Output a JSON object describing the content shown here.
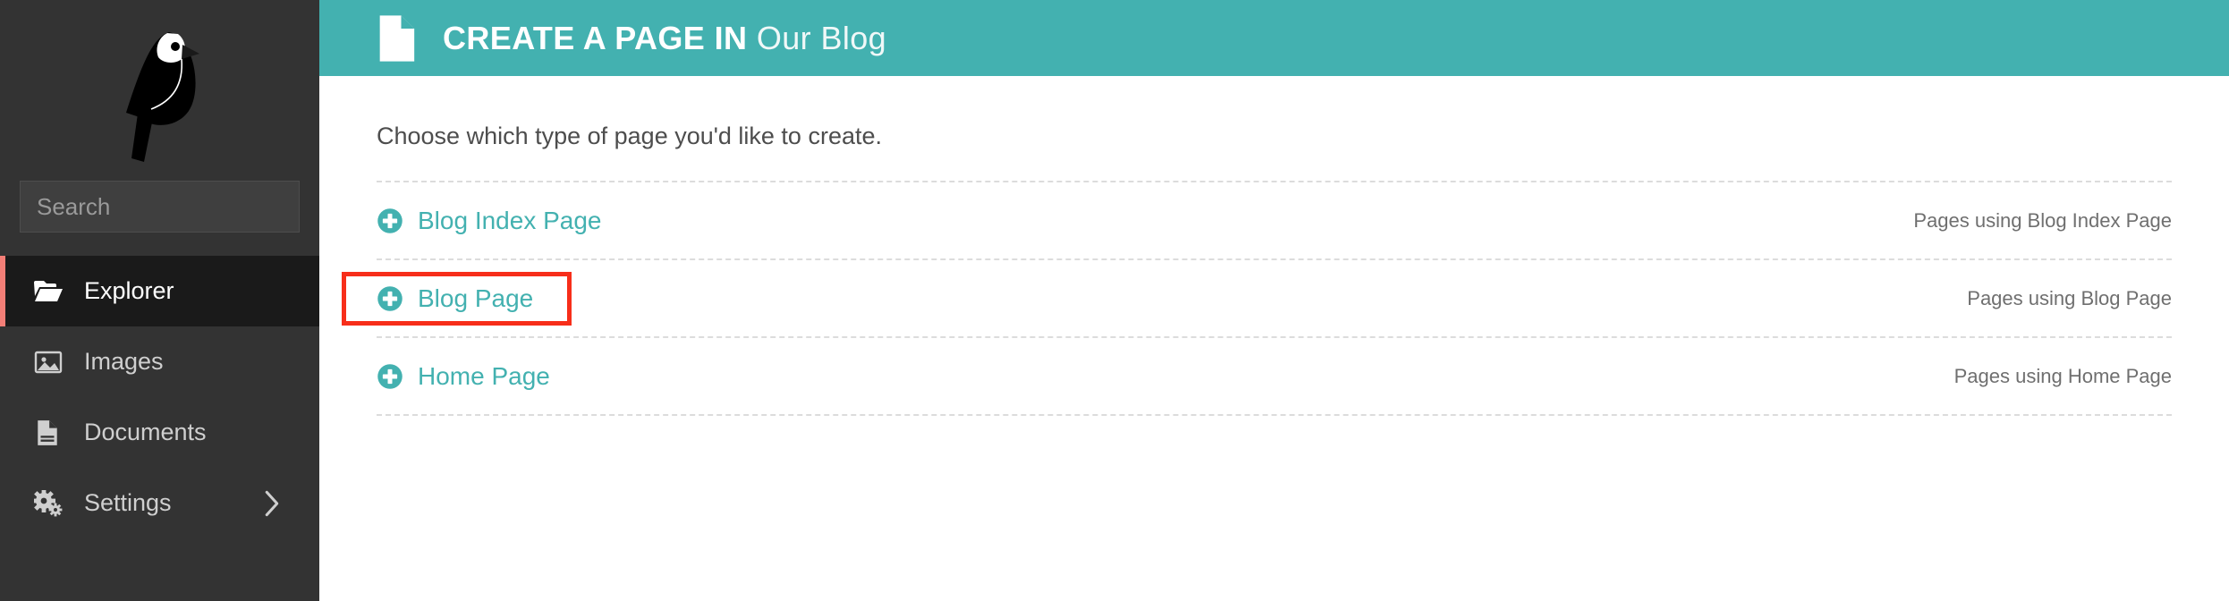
{
  "colors": {
    "brand_teal": "#43b1b0",
    "sidebar_bg": "#333333",
    "sidebar_active_bg": "#1a1a1a",
    "active_accent": "#f37e77",
    "link_teal": "#43b1b0",
    "highlight_red": "#f72e1a"
  },
  "sidebar": {
    "logo": {
      "icon": "wagtail-bird-logo",
      "alt": "Wagtail"
    },
    "search": {
      "placeholder": "Search",
      "value": "",
      "icon": "search-icon"
    },
    "items": [
      {
        "label": "Explorer",
        "icon": "folder-open-icon",
        "active": true,
        "has_arrow": false
      },
      {
        "label": "Images",
        "icon": "image-icon",
        "active": false,
        "has_arrow": false
      },
      {
        "label": "Documents",
        "icon": "document-icon",
        "active": false,
        "has_arrow": false
      },
      {
        "label": "Settings",
        "icon": "gears-icon",
        "active": false,
        "has_arrow": true
      }
    ]
  },
  "header": {
    "icon": "page-document-icon",
    "title_strong": "CREATE A PAGE IN",
    "title_soft": "Our Blog"
  },
  "main": {
    "intro": "Choose which type of page you'd like to create.",
    "page_types": [
      {
        "label": "Blog Index Page",
        "icon": "plus-circle-icon",
        "usage_label": "Pages using Blog Index Page",
        "highlighted": false
      },
      {
        "label": "Blog Page",
        "icon": "plus-circle-icon",
        "usage_label": "Pages using Blog Page",
        "highlighted": true
      },
      {
        "label": "Home Page",
        "icon": "plus-circle-icon",
        "usage_label": "Pages using Home Page",
        "highlighted": false
      }
    ]
  }
}
